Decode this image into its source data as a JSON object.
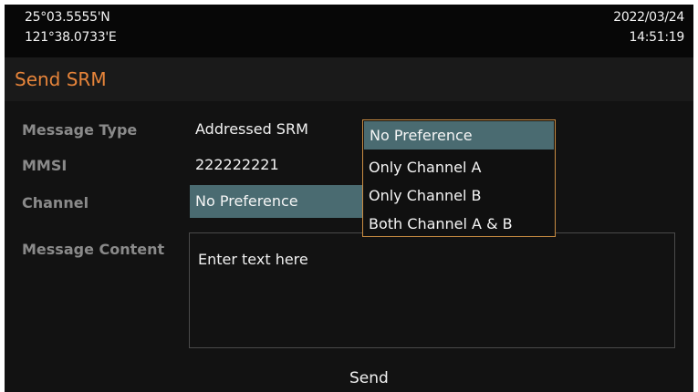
{
  "status": {
    "latitude": "25°03.5555'N",
    "longitude": "121°38.0733'E",
    "date": "2022/03/24",
    "time": "14:51:19"
  },
  "page": {
    "title": "Send SRM"
  },
  "form": {
    "message_type_label": "Message Type",
    "message_type_value": "Addressed SRM",
    "mmsi_label": "MMSI",
    "mmsi_value": "222222221",
    "channel_label": "Channel",
    "channel_value": "No Preference",
    "content_label": "Message Content",
    "content_placeholder": "Enter text here",
    "send_label": "Send"
  },
  "channel_dropdown": {
    "options": [
      "No Preference",
      "Only Channel A",
      "Only Channel B",
      "Both Channel A & B"
    ],
    "selected": "No Preference"
  },
  "colors": {
    "title": "#e6843a",
    "highlight": "#4a6b71",
    "dropdown_border": "#c98c42"
  }
}
